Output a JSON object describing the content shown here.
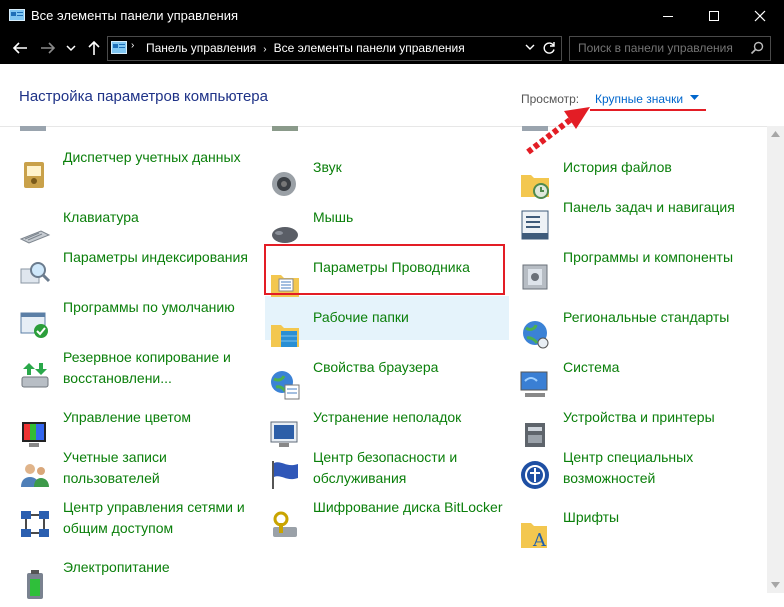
{
  "window": {
    "title": "Все элементы панели управления",
    "minimize_icon": "minimize-icon",
    "maximize_icon": "maximize-icon",
    "close_icon": "close-icon"
  },
  "address_bar": {
    "breadcrumbs": [
      "Панель управления",
      "Все элементы панели управления"
    ],
    "search_placeholder": "Поиск в панели управления"
  },
  "header": {
    "title": "Настройка параметров компьютера",
    "view_label": "Просмотр:",
    "view_value": "Крупные значки"
  },
  "items": [
    {
      "label": "Диспетчер учетных данных",
      "icon": "credential-manager-icon"
    },
    {
      "label": "Клавиатура",
      "icon": "keyboard-icon"
    },
    {
      "label": "Параметры индексирования",
      "icon": "indexing-icon"
    },
    {
      "label": "Программы по умолчанию",
      "icon": "default-programs-icon"
    },
    {
      "label": "Резервное копирование и восстановлени...",
      "icon": "backup-icon"
    },
    {
      "label": "Управление цветом",
      "icon": "color-management-icon"
    },
    {
      "label": "Учетные записи пользователей",
      "icon": "user-accounts-icon"
    },
    {
      "label": "Центр управления сетями и общим доступом",
      "icon": "network-center-icon"
    },
    {
      "label": "Электропитание",
      "icon": "power-options-icon"
    },
    {
      "label": "Звук",
      "icon": "sound-icon"
    },
    {
      "label": "Мышь",
      "icon": "mouse-icon"
    },
    {
      "label": "Параметры Проводника",
      "icon": "explorer-options-icon"
    },
    {
      "label": "Рабочие папки",
      "icon": "work-folders-icon"
    },
    {
      "label": "Свойства браузера",
      "icon": "internet-options-icon"
    },
    {
      "label": "Устранение неполадок",
      "icon": "troubleshooting-icon"
    },
    {
      "label": "Центр безопасности и обслуживания",
      "icon": "security-center-icon"
    },
    {
      "label": "Шифрование диска BitLocker",
      "icon": "bitlocker-icon"
    },
    {
      "label": "История файлов",
      "icon": "file-history-icon"
    },
    {
      "label": "Панель задач и навигация",
      "icon": "taskbar-icon"
    },
    {
      "label": "Программы и компоненты",
      "icon": "programs-features-icon"
    },
    {
      "label": "Региональные стандарты",
      "icon": "region-icon"
    },
    {
      "label": "Система",
      "icon": "system-icon"
    },
    {
      "label": "Устройства и принтеры",
      "icon": "devices-printers-icon"
    },
    {
      "label": "Центр специальных возможностей",
      "icon": "ease-of-access-icon"
    },
    {
      "label": "Шрифты",
      "icon": "fonts-icon"
    }
  ]
}
